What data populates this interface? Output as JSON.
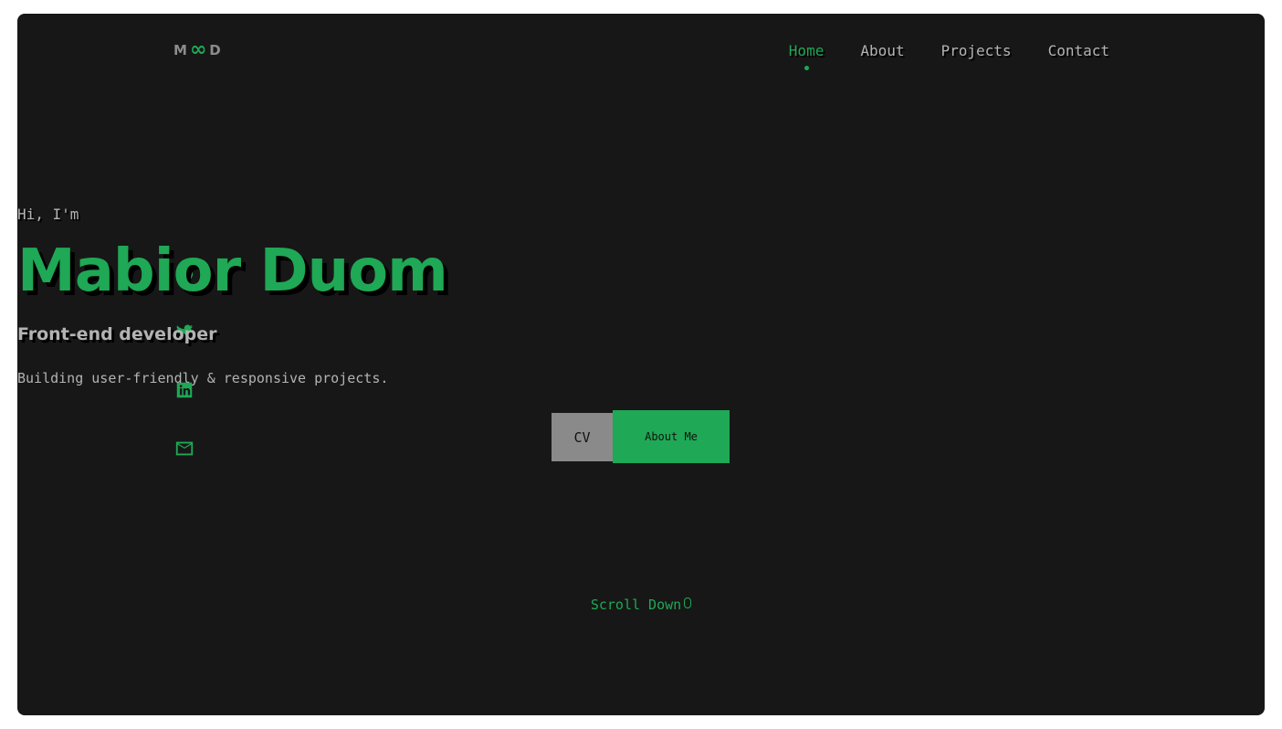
{
  "logo": {
    "left": "M",
    "middle": "∞",
    "right": "D"
  },
  "nav": {
    "items": [
      {
        "label": "Home",
        "active": true
      },
      {
        "label": "About",
        "active": false
      },
      {
        "label": "Projects",
        "active": false
      },
      {
        "label": "Contact",
        "active": false
      }
    ]
  },
  "hero": {
    "greeting": "Hi, I'm",
    "name": "Mabior Duom",
    "role": "Front-end developer",
    "tagline": "Building user-friendly & responsive projects.",
    "cv_label": "CV",
    "about_label": "About Me",
    "scroll_label": "Scroll Down"
  },
  "socials": [
    "github-icon",
    "twitter-icon",
    "linkedin-icon",
    "email-icon"
  ],
  "colors": {
    "accent": "#1fa855",
    "background": "#171717",
    "text": "#b3b3b3"
  }
}
